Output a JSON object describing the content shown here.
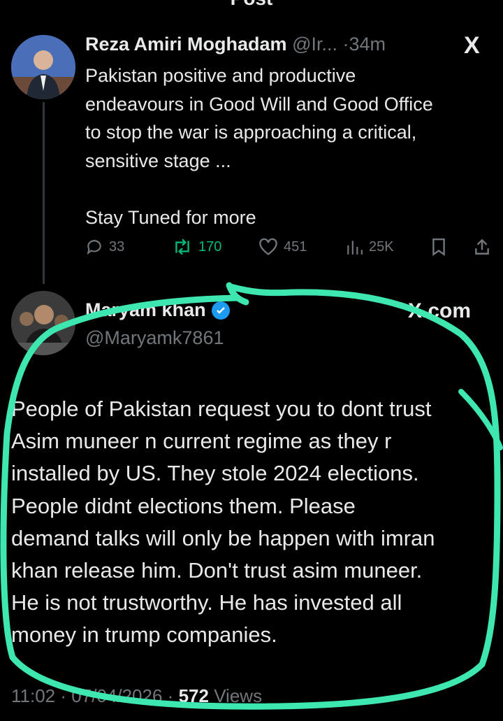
{
  "header": {
    "title": "Post"
  },
  "quoted_tweet": {
    "name": "Reza Amiri Moghadam",
    "handle": "@Ir...",
    "separator": "·",
    "time": "34m",
    "platform_logo": "X",
    "lines": [
      "Pakistan positive and productive",
      "endeavours in Good Will and Good Office",
      "to stop the war is approaching a critical,",
      "sensitive stage ..."
    ],
    "last_line": "Stay Tuned for more",
    "stats": {
      "replies": "33",
      "retweets": "170",
      "likes": "451",
      "views": "25K"
    },
    "icons": [
      "reply-icon",
      "retweet-icon",
      "like-icon",
      "views-icon",
      "bookmark-icon",
      "share-icon"
    ]
  },
  "main_tweet": {
    "name": "Maryam khan",
    "handle": "@Maryamk7861",
    "watermark": "X.com",
    "lines": [
      "People of Pakistan request you to dont trust",
      "Asim muneer n current regime as they r",
      "installed by US. They stole 2024 elections.",
      "People didnt elections them. Please",
      "demand talks will only be happen with imran",
      "khan release him. Don't trust asim muneer.",
      "He is not trustworthy.  He has invested all",
      "money in trump companies."
    ],
    "time": "11:02",
    "date": "07/04/2026",
    "dot": "·",
    "views_count": "572",
    "views_label": "Views"
  },
  "colors": {
    "background": "#000000",
    "text": "#e7e9ea",
    "muted": "#71767b",
    "retweet": "#00ba7c",
    "verified": "#1d9bf0",
    "annotation": "#3ee6b0"
  }
}
